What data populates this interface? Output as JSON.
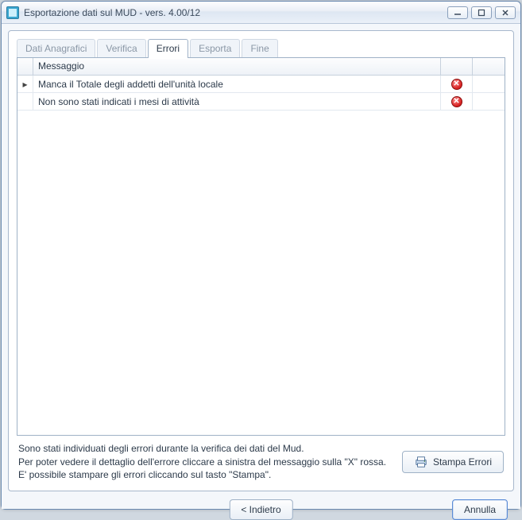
{
  "window": {
    "title": "Esportazione dati sul MUD - vers. 4.00/12"
  },
  "tabs": {
    "items": [
      {
        "label": "Dati Anagrafici",
        "active": false
      },
      {
        "label": "Verifica",
        "active": false
      },
      {
        "label": "Errori",
        "active": true
      },
      {
        "label": "Esporta",
        "active": false
      },
      {
        "label": "Fine",
        "active": false
      }
    ]
  },
  "grid": {
    "header": "Messaggio",
    "rows": [
      {
        "current": true,
        "message": "Manca il Totale degli addetti dell'unità locale"
      },
      {
        "current": false,
        "message": "Non sono stati indicati i mesi di attività"
      }
    ]
  },
  "footer": {
    "line1": "Sono stati individuati degli errori durante la verifica dei dati del Mud.",
    "line2": "Per poter vedere il dettaglio dell'errore cliccare a sinistra del messaggio sulla \"X\" rossa.",
    "line3": "E' possibile stampare gli errori cliccando sul tasto \"Stampa\".",
    "print_label": "Stampa Errori"
  },
  "buttons": {
    "back": "< Indietro",
    "cancel": "Annulla"
  }
}
